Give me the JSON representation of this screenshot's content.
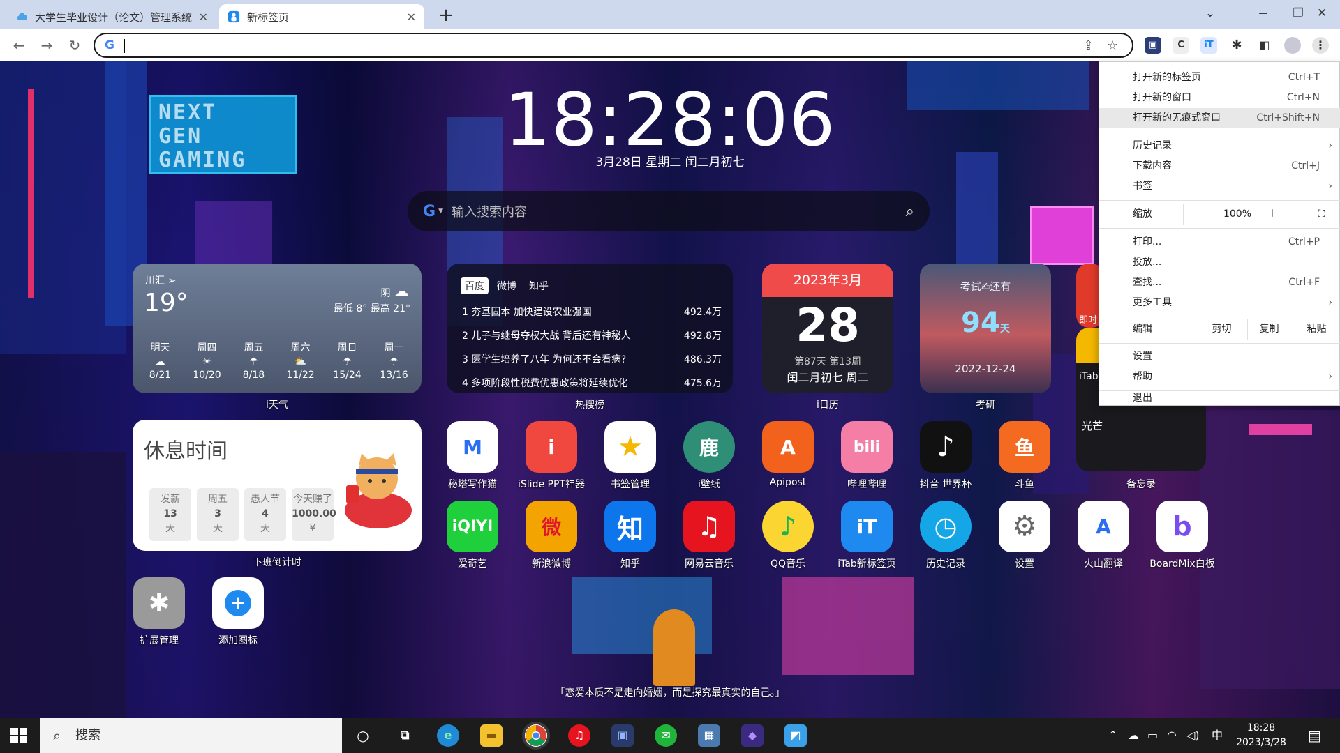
{
  "browser": {
    "tabs": [
      {
        "title": "大学生毕业设计（论文）管理系统",
        "active": false
      },
      {
        "title": "新标签页",
        "active": true
      }
    ],
    "new_tab_symbol": "+",
    "window_controls": {
      "minimize": "⌄",
      "restore": "❐",
      "close": "✕"
    },
    "nav": {
      "back": "←",
      "forward": "→",
      "reload": "↻"
    },
    "address_value": "",
    "omnibox_g": "G",
    "extensions": [
      "C",
      "iT"
    ]
  },
  "clock": {
    "time": "18:28:06",
    "date": "3月28日 星期二 闰二月初七"
  },
  "search": {
    "placeholder": "输入搜索内容",
    "engine": "G"
  },
  "weather": {
    "location": "川汇",
    "location_icon": "➢",
    "temp": "19°",
    "condition": "阴",
    "range": "最低 8° 最高 21°",
    "forecast": [
      {
        "day": "明天",
        "icon": "☁",
        "range": "8/21"
      },
      {
        "day": "周四",
        "icon": "☀",
        "range": "10/20"
      },
      {
        "day": "周五",
        "icon": "☂",
        "range": "8/18"
      },
      {
        "day": "周六",
        "icon": "⛅",
        "range": "11/22"
      },
      {
        "day": "周日",
        "icon": "☂",
        "range": "15/24"
      },
      {
        "day": "周一",
        "icon": "☂",
        "range": "13/16"
      }
    ],
    "label": "i天气"
  },
  "hot": {
    "tabs": [
      "百度",
      "微博",
      "知乎"
    ],
    "rows": [
      {
        "title": "1  夯基固本 加快建设农业强国",
        "value": "492.4万"
      },
      {
        "title": "2  儿子与继母夺权大战 背后还有神秘人",
        "value": "492.8万"
      },
      {
        "title": "3  医学生培养了八年 为何还不会看病?",
        "value": "486.3万"
      },
      {
        "title": "4  多项阶段性税费优惠政策将延续优化",
        "value": "475.6万"
      }
    ],
    "label": "热搜榜"
  },
  "calendar": {
    "month": "2023年3月",
    "day": "28",
    "week_info": "第87天 第13周",
    "lunar": "闰二月初七 周二",
    "label": "i日历"
  },
  "exam": {
    "title": "考试✍还有",
    "days": "94",
    "unit": "天",
    "date": "2022-12-24",
    "label": "考研"
  },
  "rest": {
    "title": "休息时间",
    "items": [
      {
        "name": "发薪",
        "value": "13",
        "unit": "天"
      },
      {
        "name": "周五",
        "value": "3",
        "unit": "天"
      },
      {
        "name": "愚人节",
        "value": "4",
        "unit": "天"
      },
      {
        "name": "今天赚了",
        "value": "1000.00",
        "unit": "¥"
      }
    ],
    "label": "下班倒计时"
  },
  "memo": {
    "partial_app1": "即时",
    "partial_app2": "iTab",
    "text": "光芒",
    "label": "备忘录"
  },
  "apps_row1": [
    {
      "label": "秘塔写作猫",
      "glyph": "M",
      "bg": "#ffffff",
      "fg": "#2a6ef5"
    },
    {
      "label": "iSlide PPT神器",
      "glyph": "i",
      "bg": "#f0483e",
      "fg": "#ffffff"
    },
    {
      "label": "书签管理",
      "glyph": "★",
      "bg": "#ffffff",
      "fg": "#f5b800"
    },
    {
      "label": "i壁纸",
      "glyph": "鹿",
      "bg": "#2f8f76",
      "fg": "#ffffff"
    },
    {
      "label": "Apipost",
      "glyph": "A",
      "bg": "#f2621c",
      "fg": "#ffffff"
    },
    {
      "label": "哔哩哔哩",
      "glyph": "bili",
      "bg": "#f57ea6",
      "fg": "#ffffff"
    },
    {
      "label": "抖音 世界杯",
      "glyph": "♪",
      "bg": "#111111",
      "fg": "#ffffff"
    },
    {
      "label": "斗鱼",
      "glyph": "鱼",
      "bg": "#f46a20",
      "fg": "#ffffff"
    }
  ],
  "apps_row2": [
    {
      "label": "爱奇艺",
      "glyph": "iQIYI",
      "bg": "#1fcf3b",
      "fg": "#ffffff"
    },
    {
      "label": "新浪微博",
      "glyph": "微",
      "bg": "#f4a400",
      "fg": "#e0142d"
    },
    {
      "label": "知乎",
      "glyph": "知",
      "bg": "#0e76ec",
      "fg": "#ffffff"
    },
    {
      "label": "网易云音乐",
      "glyph": "♫",
      "bg": "#e5141f",
      "fg": "#ffffff"
    },
    {
      "label": "QQ音乐",
      "glyph": "♪",
      "bg": "#fbd633",
      "fg": "#19b352"
    },
    {
      "label": "iTab新标签页",
      "glyph": "iT",
      "bg": "#1e8af0",
      "fg": "#ffffff"
    },
    {
      "label": "历史记录",
      "glyph": "◷",
      "bg": "#15a6e8",
      "fg": "#ffffff"
    },
    {
      "label": "设置",
      "glyph": "⚙",
      "bg": "#ffffff",
      "fg": "#666666"
    },
    {
      "label": "火山翻译",
      "glyph": "A",
      "bg": "#ffffff",
      "fg": "#2b6ef2"
    },
    {
      "label": "BoardMix白板",
      "glyph": "b",
      "bg": "#ffffff",
      "fg": "#7a4df0"
    }
  ],
  "apps_row3": [
    {
      "label": "扩展管理",
      "glyph": "✱",
      "bg": "#9a9a9a",
      "fg": "#ffffff"
    },
    {
      "label": "添加图标",
      "glyph": "+",
      "bg": "#ffffff",
      "fg": "#1e8af0"
    }
  ],
  "quote": "「恋爱本质不是走向婚姻，而是探究最真实的自己。」",
  "menu": {
    "group1": [
      {
        "label": "打开新的标签页",
        "shortcut": "Ctrl+T"
      },
      {
        "label": "打开新的窗口",
        "shortcut": "Ctrl+N"
      },
      {
        "label": "打开新的无痕式窗口",
        "shortcut": "Ctrl+Shift+N"
      }
    ],
    "group2": [
      {
        "label": "历史记录",
        "shortcut": "",
        "arrow": "›"
      },
      {
        "label": "下载内容",
        "shortcut": "Ctrl+J",
        "arrow": ""
      },
      {
        "label": "书签",
        "shortcut": "",
        "arrow": "›"
      }
    ],
    "zoom": {
      "label": "缩放",
      "minus": "－",
      "value": "100%",
      "plus": "＋",
      "fullscreen": "⛶"
    },
    "group3": [
      {
        "label": "打印...",
        "shortcut": "Ctrl+P",
        "arrow": ""
      },
      {
        "label": "投放...",
        "shortcut": "",
        "arrow": ""
      },
      {
        "label": "查找...",
        "shortcut": "Ctrl+F",
        "arrow": ""
      },
      {
        "label": "更多工具",
        "shortcut": "",
        "arrow": "›"
      }
    ],
    "edit": {
      "label": "编辑",
      "cut": "剪切",
      "copy": "复制",
      "paste": "粘贴"
    },
    "group4": [
      {
        "label": "设置",
        "arrow": ""
      },
      {
        "label": "帮助",
        "arrow": "›"
      }
    ],
    "exit": "退出"
  },
  "taskbar": {
    "search_placeholder": "搜索",
    "tray": {
      "chevron": "⌃",
      "ime": "中",
      "time": "18:28",
      "date": "2023/3/28"
    }
  }
}
